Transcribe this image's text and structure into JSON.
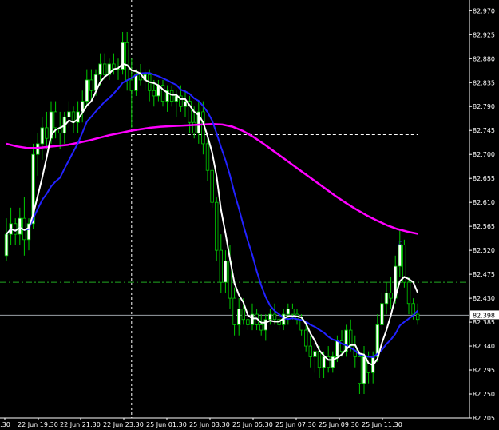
{
  "chart_data": {
    "type": "line",
    "chart_kind": "candlestick",
    "y_axis": {
      "side": "right",
      "ticks": [
        "82.970",
        "82.925",
        "82.880",
        "82.835",
        "82.790",
        "82.745",
        "82.700",
        "82.655",
        "82.610",
        "82.565",
        "82.520",
        "82.475",
        "82.430",
        "82.385",
        "82.340",
        "82.295",
        "82.250",
        "82.205"
      ],
      "range": [
        82.205,
        82.99
      ]
    },
    "x_axis": {
      "ticks": [
        ":30",
        "22 Jun 19:30",
        "22 Jun 21:30",
        "22 Jun 23:30",
        "25 Jun 01:30",
        "25 Jun 03:30",
        "25 Jun 05:30",
        "25 Jun 07:30",
        "25 Jun 09:30",
        "25 Jun 11:30"
      ]
    },
    "current_price_label": "82.398",
    "current_price": 82.398,
    "horizontal_levels": [
      {
        "value": 82.398,
        "style": "solid",
        "color": "#9aa0a6"
      },
      {
        "value": 82.46,
        "style": "dashdot",
        "color": "#22aa22"
      }
    ],
    "trendline_segments": [
      {
        "from_bar": 0,
        "to_bar": 26,
        "value": 82.575,
        "color": "#ffffff"
      },
      {
        "from_bar": 28,
        "to_bar": 92,
        "value": 82.737,
        "color": "#ffffff"
      }
    ],
    "crosshair_bar": 28,
    "marker": {
      "bar": 88,
      "value": 82.528,
      "glyph": "⚐",
      "color": "#3344ff"
    },
    "colors": {
      "background": "#000000",
      "candle_bull": "#ffffff",
      "candle_bear": "#000000",
      "candle_outline": "#00cc00",
      "wick": "#00cc00",
      "ma_fast": "#ffffff",
      "ma_mid": "#2222ff",
      "ma_slow": "#ff00ff"
    },
    "series": [
      {
        "key": "candles",
        "ohlc": [
          [
            82.51,
            82.58,
            82.5,
            82.55
          ],
          [
            82.55,
            82.6,
            82.53,
            82.57
          ],
          [
            82.57,
            82.58,
            82.53,
            82.55
          ],
          [
            82.55,
            82.6,
            82.53,
            82.58
          ],
          [
            82.58,
            82.62,
            82.51,
            82.54
          ],
          [
            82.54,
            82.58,
            82.52,
            82.57
          ],
          [
            82.57,
            82.72,
            82.56,
            82.7
          ],
          [
            82.7,
            82.74,
            82.66,
            82.72
          ],
          [
            82.72,
            82.77,
            82.69,
            82.75
          ],
          [
            82.75,
            82.78,
            82.71,
            82.73
          ],
          [
            82.73,
            82.8,
            82.72,
            82.78
          ],
          [
            82.78,
            82.8,
            82.73,
            82.75
          ],
          [
            82.75,
            82.78,
            82.71,
            82.74
          ],
          [
            82.74,
            82.78,
            82.72,
            82.77
          ],
          [
            82.77,
            82.8,
            82.75,
            82.78
          ],
          [
            82.78,
            82.79,
            82.74,
            82.76
          ],
          [
            82.76,
            82.8,
            82.74,
            82.78
          ],
          [
            82.78,
            82.82,
            82.76,
            82.8
          ],
          [
            82.8,
            82.86,
            82.79,
            82.84
          ],
          [
            82.84,
            82.86,
            82.8,
            82.82
          ],
          [
            82.82,
            82.86,
            82.81,
            82.85
          ],
          [
            82.85,
            82.89,
            82.83,
            82.87
          ],
          [
            82.87,
            82.89,
            82.84,
            82.85
          ],
          [
            82.85,
            82.88,
            82.84,
            82.87
          ],
          [
            82.87,
            82.89,
            82.85,
            82.86
          ],
          [
            82.86,
            82.88,
            82.84,
            82.86
          ],
          [
            82.86,
            82.93,
            82.85,
            82.91
          ],
          [
            82.91,
            82.93,
            82.82,
            82.84
          ],
          [
            82.84,
            82.88,
            82.75,
            82.82
          ],
          [
            82.82,
            82.86,
            82.81,
            82.85
          ],
          [
            82.85,
            82.87,
            82.83,
            82.84
          ],
          [
            82.84,
            82.86,
            82.82,
            82.85
          ],
          [
            82.85,
            82.86,
            82.8,
            82.82
          ],
          [
            82.82,
            82.84,
            82.79,
            82.81
          ],
          [
            82.81,
            82.84,
            82.8,
            82.83
          ],
          [
            82.83,
            82.84,
            82.79,
            82.8
          ],
          [
            82.8,
            82.83,
            82.78,
            82.82
          ],
          [
            82.82,
            82.83,
            82.79,
            82.8
          ],
          [
            82.8,
            82.82,
            82.77,
            82.81
          ],
          [
            82.81,
            82.83,
            82.78,
            82.79
          ],
          [
            82.79,
            82.82,
            82.77,
            82.8
          ],
          [
            82.8,
            82.81,
            82.74,
            82.76
          ],
          [
            82.76,
            82.79,
            82.73,
            82.74
          ],
          [
            82.74,
            82.8,
            82.72,
            82.78
          ],
          [
            82.78,
            82.8,
            82.7,
            82.72
          ],
          [
            82.72,
            82.74,
            82.65,
            82.67
          ],
          [
            82.67,
            82.68,
            82.6,
            82.61
          ],
          [
            82.61,
            82.62,
            82.5,
            82.52
          ],
          [
            82.52,
            82.55,
            82.44,
            82.46
          ],
          [
            82.46,
            82.52,
            82.44,
            82.5
          ],
          [
            82.5,
            82.53,
            82.41,
            82.43
          ],
          [
            82.43,
            82.45,
            82.36,
            82.38
          ],
          [
            82.38,
            82.43,
            82.36,
            82.41
          ],
          [
            82.41,
            82.43,
            82.38,
            82.39
          ],
          [
            82.39,
            82.41,
            82.37,
            82.38
          ],
          [
            82.38,
            82.42,
            82.37,
            82.4
          ],
          [
            82.4,
            82.41,
            82.37,
            82.38
          ],
          [
            82.38,
            82.4,
            82.36,
            82.37
          ],
          [
            82.37,
            82.4,
            82.35,
            82.39
          ],
          [
            82.39,
            82.41,
            82.38,
            82.4
          ],
          [
            82.4,
            82.42,
            82.38,
            82.39
          ],
          [
            82.39,
            82.4,
            82.37,
            82.38
          ],
          [
            82.38,
            82.41,
            82.37,
            82.4
          ],
          [
            82.4,
            82.42,
            82.38,
            82.41
          ],
          [
            82.41,
            82.42,
            82.39,
            82.4
          ],
          [
            82.4,
            82.41,
            82.38,
            82.39
          ],
          [
            82.39,
            82.4,
            82.36,
            82.37
          ],
          [
            82.37,
            82.38,
            82.33,
            82.34
          ],
          [
            82.34,
            82.36,
            82.3,
            82.32
          ],
          [
            82.32,
            82.35,
            82.29,
            82.33
          ],
          [
            82.33,
            82.34,
            82.28,
            82.3
          ],
          [
            82.3,
            82.33,
            82.28,
            82.32
          ],
          [
            82.32,
            82.34,
            82.29,
            82.3
          ],
          [
            82.3,
            82.33,
            82.29,
            82.32
          ],
          [
            82.32,
            82.36,
            82.31,
            82.35
          ],
          [
            82.35,
            82.37,
            82.32,
            82.33
          ],
          [
            82.33,
            82.38,
            82.32,
            82.37
          ],
          [
            82.37,
            82.39,
            82.33,
            82.34
          ],
          [
            82.34,
            82.36,
            82.3,
            82.32
          ],
          [
            82.32,
            82.33,
            82.25,
            82.27
          ],
          [
            82.27,
            82.34,
            82.25,
            82.32
          ],
          [
            82.32,
            82.33,
            82.27,
            82.29
          ],
          [
            82.29,
            82.33,
            82.27,
            82.32
          ],
          [
            82.32,
            82.4,
            82.31,
            82.38
          ],
          [
            82.38,
            82.44,
            82.37,
            82.42
          ],
          [
            82.42,
            82.46,
            82.4,
            82.44
          ],
          [
            82.44,
            82.47,
            82.41,
            82.43
          ],
          [
            82.43,
            82.51,
            82.42,
            82.49
          ],
          [
            82.49,
            82.56,
            82.47,
            82.53
          ],
          [
            82.53,
            82.54,
            82.45,
            82.46
          ],
          [
            82.46,
            82.47,
            82.4,
            82.42
          ],
          [
            82.42,
            82.43,
            82.39,
            82.4
          ],
          [
            82.4,
            82.42,
            82.38,
            82.39
          ]
        ]
      },
      {
        "key": "ma_fast",
        "period": 5
      },
      {
        "key": "ma_mid",
        "period": 13
      },
      {
        "key": "ma_slow",
        "values": [
          82.72,
          82.715,
          82.712,
          82.712,
          82.714,
          82.716,
          82.718,
          82.722,
          82.726,
          82.731,
          82.736,
          82.74,
          82.744,
          82.747,
          82.75,
          82.752,
          82.753,
          82.754,
          82.755,
          82.756,
          82.757,
          82.756,
          82.752,
          82.744,
          82.733,
          82.72,
          82.706,
          82.692,
          82.678,
          82.664,
          82.65,
          82.636,
          82.622,
          82.609,
          82.597,
          82.586,
          82.576,
          82.567,
          82.56,
          82.555,
          82.551
        ]
      }
    ]
  }
}
